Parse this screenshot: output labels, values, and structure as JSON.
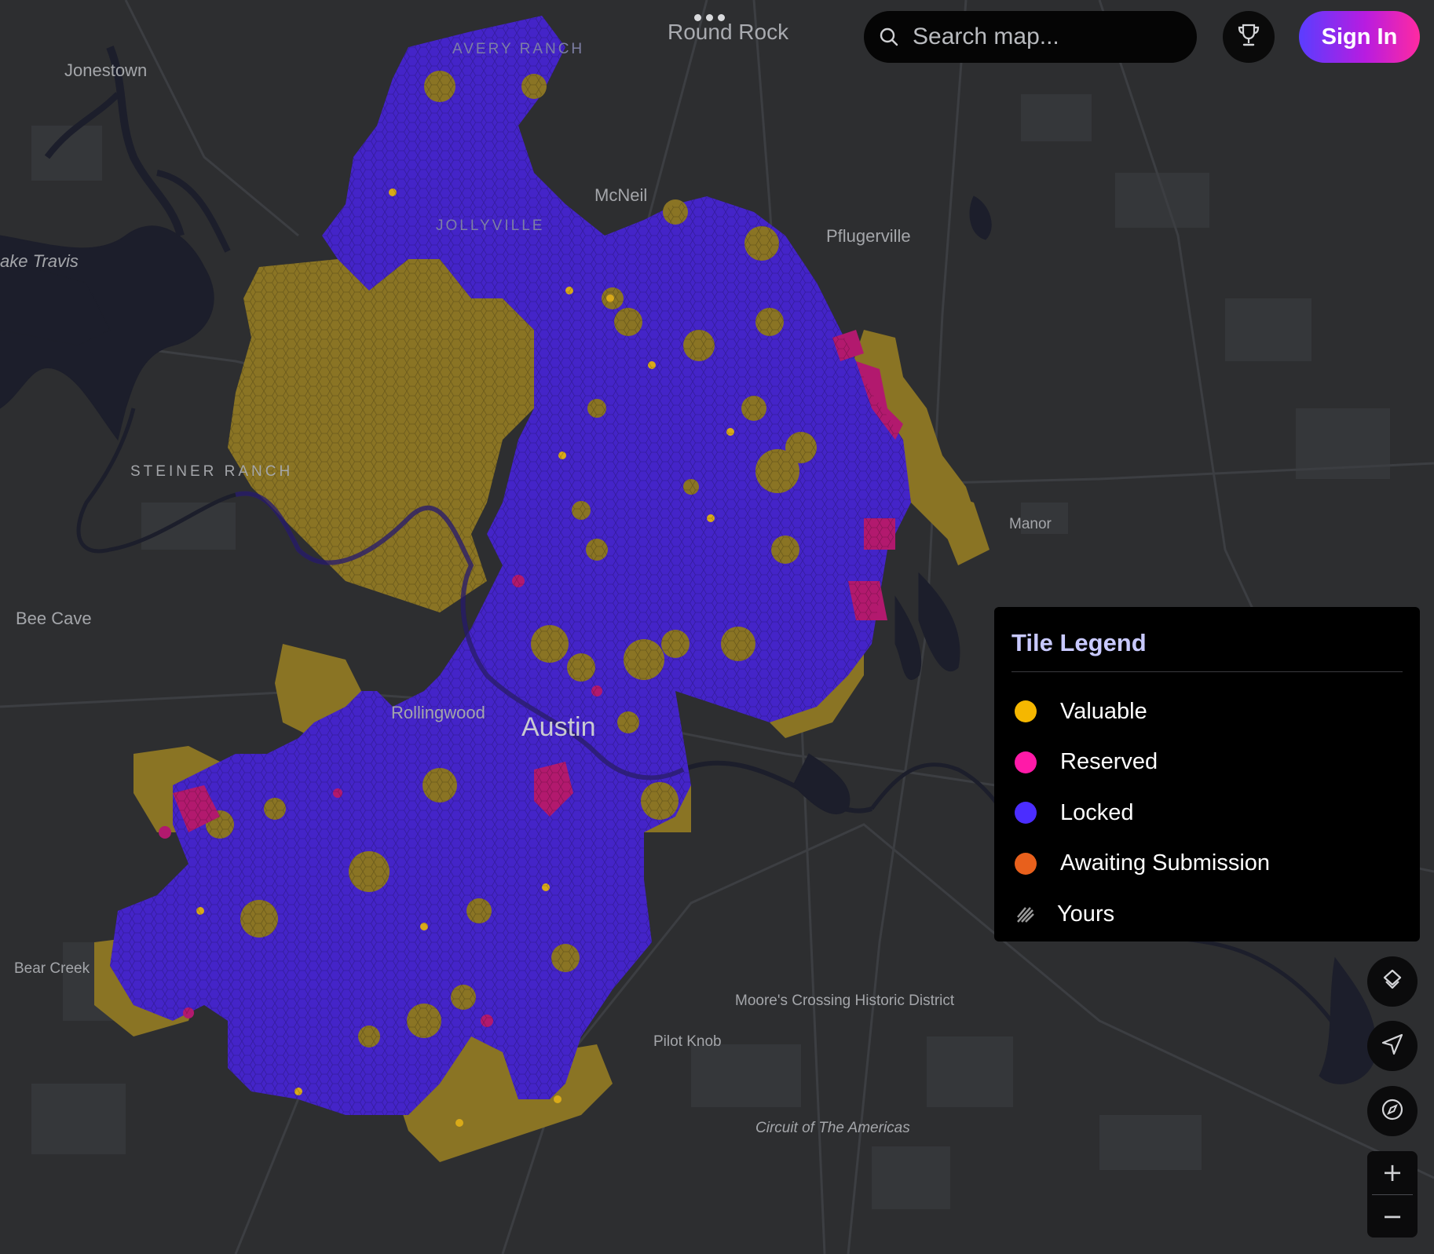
{
  "search": {
    "placeholder": "Search map..."
  },
  "header": {
    "sign_in_label": "Sign In"
  },
  "legend": {
    "title": "Tile Legend",
    "items": [
      {
        "label": "Valuable",
        "color": "#f5b700",
        "icon": "dot"
      },
      {
        "label": "Reserved",
        "color": "#ff1aa8",
        "icon": "dot"
      },
      {
        "label": "Locked",
        "color": "#4b2dff",
        "icon": "dot"
      },
      {
        "label": "Awaiting Submission",
        "color": "#e8601c",
        "icon": "dot"
      },
      {
        "label": "Yours",
        "color": "#9a9a9a",
        "icon": "hatch-icon"
      }
    ]
  },
  "map": {
    "places": {
      "round_rock": "Round Rock",
      "jonestown": "Jonestown",
      "avery_ranch": "AVERY RANCH",
      "mcneil": "McNeil",
      "jollyville": "JOLLYVILLE",
      "pflugerville": "Pflugerville",
      "lake_travis": "ake Travis",
      "steiner_ranch": "STEINER RANCH",
      "manor": "Manor",
      "bee_cave": "Bee Cave",
      "rollingwood": "Rollingwood",
      "austin": "Austin",
      "bear_creek": "Bear Creek",
      "moores_crossing": "Moore's Crossing Historic District",
      "pilot_knob": "Pilot Knob",
      "circuit": "Circuit of The Americas"
    },
    "colors": {
      "land": "#2d2e30",
      "water": "#1d1f2b",
      "locked": "#4424c8",
      "valuable": "#8a7424",
      "reserved": "#b2196e",
      "valuable_dot": "#d9aa18"
    }
  },
  "controls": {
    "icons": [
      "trophy-icon",
      "search-icon",
      "layers-icon",
      "locate-icon",
      "compass-icon"
    ],
    "zoom_in": "+",
    "zoom_out": "−"
  }
}
